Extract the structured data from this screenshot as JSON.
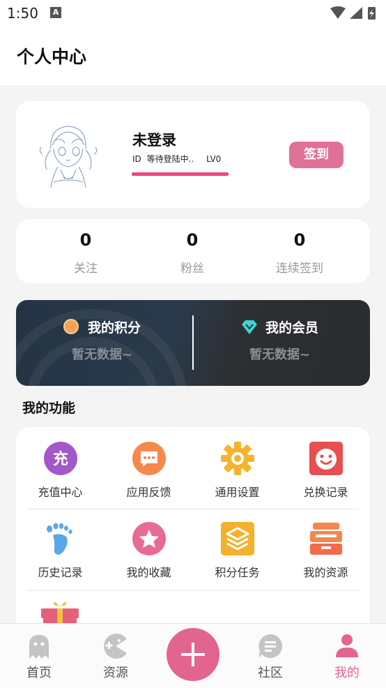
{
  "status_bar": {
    "time": "1:50",
    "notification_icon": "A"
  },
  "header": {
    "title": "个人中心"
  },
  "profile": {
    "username": "未登录",
    "id_label": "ID",
    "id_value": "等待登陆中..",
    "level": "LV0",
    "sign_button": "签到",
    "avatar_icon": "anime-girl-avatar"
  },
  "stats": [
    {
      "value": "0",
      "label": "关注"
    },
    {
      "value": "0",
      "label": "粉丝"
    },
    {
      "value": "0",
      "label": "连续签到"
    }
  ],
  "wallet": {
    "points": {
      "title": "我的积分",
      "sub": "暂无数据~",
      "icon": "coin-icon"
    },
    "vip": {
      "title": "我的会员",
      "sub": "暂无数据~",
      "icon": "diamond-icon"
    }
  },
  "functions_title": "我的功能",
  "functions": [
    {
      "label": "充值中心",
      "icon": "recharge-icon",
      "glyph": "充",
      "color": "#a258c9"
    },
    {
      "label": "应用反馈",
      "icon": "feedback-icon",
      "color": "#f5884b"
    },
    {
      "label": "通用设置",
      "icon": "gear-icon",
      "color": "#f4b42c"
    },
    {
      "label": "兑换记录",
      "icon": "smile-box-icon",
      "color": "#e84f50"
    },
    {
      "label": "历史记录",
      "icon": "footprint-icon",
      "color": "#5aa6ea"
    },
    {
      "label": "我的收藏",
      "icon": "star-icon",
      "color": "#e76b92"
    },
    {
      "label": "积分任务",
      "icon": "layers-icon",
      "color": "#f3b12c"
    },
    {
      "label": "我的资源",
      "icon": "drawer-icon",
      "color": "#f5884b"
    }
  ],
  "tabs": [
    {
      "label": "首页",
      "icon": "ghost-icon"
    },
    {
      "label": "资源",
      "icon": "gamepad-icon"
    },
    {
      "label": "社区",
      "icon": "chat-icon"
    },
    {
      "label": "我的",
      "icon": "user-icon",
      "active": true
    }
  ],
  "colors": {
    "accent": "#e2658f",
    "sign": "#e07096",
    "underline": "#ef4583"
  }
}
